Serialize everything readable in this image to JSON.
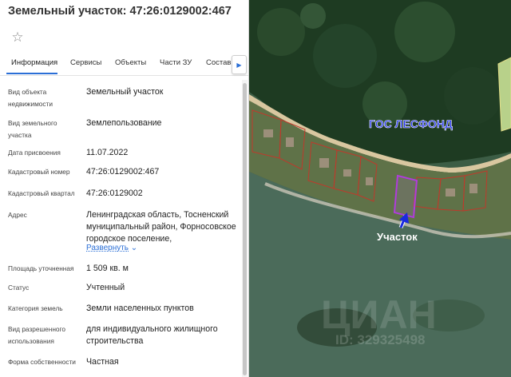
{
  "header": {
    "title": "Земельный участок: 47:26:0129002:467",
    "favorite_icon": "star-outline-icon"
  },
  "tabs": [
    {
      "label": "Информация",
      "active": true
    },
    {
      "label": "Сервисы"
    },
    {
      "label": "Объекты"
    },
    {
      "label": "Части ЗУ"
    },
    {
      "label": "Состав"
    }
  ],
  "tabs_scroll_icon": "chevron-right-icon",
  "info": {
    "object_type": {
      "label": "Вид объекта недвижимости",
      "value": "Земельный участок"
    },
    "land_type": {
      "label": "Вид земельного участка",
      "value": "Землепользование"
    },
    "assigned_date": {
      "label": "Дата присвоения",
      "value": "11.07.2022"
    },
    "cadastral_number": {
      "label": "Кадастровый номер",
      "value": "47:26:0129002:467"
    },
    "cadastral_quarter": {
      "label": "Кадастровый квартал",
      "value": "47:26:0129002"
    },
    "address": {
      "label": "Адрес",
      "value": "Ленинградская область, Тосненский муниципальный район, Форносовское городское поселение,",
      "expand_label": "Развернуть"
    },
    "area": {
      "label": "Площадь уточненная",
      "value": "1 509 кв. м"
    },
    "status": {
      "label": "Статус",
      "value": "Учтенный"
    },
    "land_category": {
      "label": "Категория земель",
      "value": "Земли населенных пунктов"
    },
    "permitted_use": {
      "label": "Вид разрешенного использования",
      "value": "для индивидуального жилищного строительства"
    },
    "ownership": {
      "label": "Форма собственности",
      "value": "Частная"
    }
  },
  "map": {
    "forest_label": "ГОС ЛЕСФОНД",
    "parcel_label": "Участок",
    "watermark": "ЦИАН",
    "watermark_id": "ID: 329325498",
    "colors": {
      "parcel_border": "#b03cdc",
      "boundary": "#c0392b",
      "forest_label": "#2233ee",
      "pointer": "#1a2ae0"
    }
  }
}
